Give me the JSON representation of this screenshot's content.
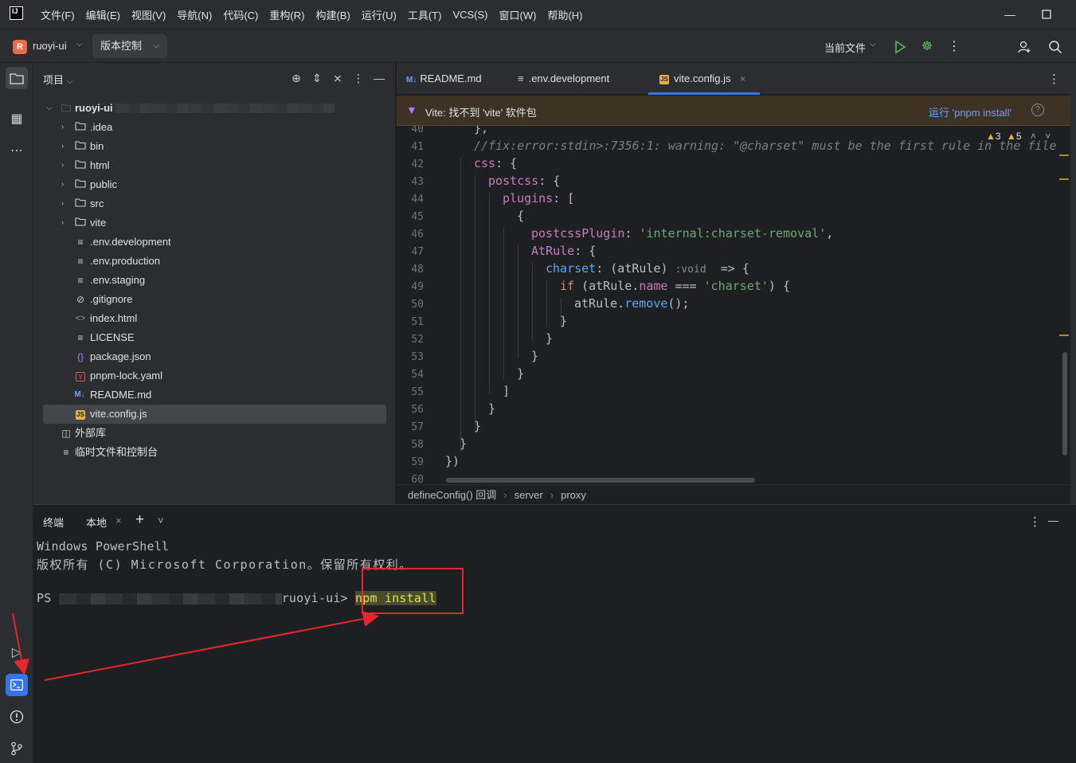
{
  "app": {
    "logo": "IJ",
    "menu": [
      "文件(F)",
      "编辑(E)",
      "视图(V)",
      "导航(N)",
      "代码(C)",
      "重构(R)",
      "构建(B)",
      "运行(U)",
      "工具(T)",
      "VCS(S)",
      "窗口(W)",
      "帮助(H)"
    ]
  },
  "toolbar": {
    "project_badge": "R",
    "project_name": "ruoyi-ui",
    "vcs_label": "版本控制",
    "run_config": "当前文件"
  },
  "project_panel": {
    "title": "项目",
    "root": "ruoyi-ui",
    "items": [
      {
        "label": ".idea",
        "type": "folder"
      },
      {
        "label": "bin",
        "type": "folder"
      },
      {
        "label": "html",
        "type": "folder"
      },
      {
        "label": "public",
        "type": "folder"
      },
      {
        "label": "src",
        "type": "folder"
      },
      {
        "label": "vite",
        "type": "folder"
      },
      {
        "label": ".env.development",
        "type": "text"
      },
      {
        "label": ".env.production",
        "type": "text"
      },
      {
        "label": ".env.staging",
        "type": "text"
      },
      {
        "label": ".gitignore",
        "type": "ignore"
      },
      {
        "label": "index.html",
        "type": "html"
      },
      {
        "label": "LICENSE",
        "type": "text"
      },
      {
        "label": "package.json",
        "type": "json"
      },
      {
        "label": "pnpm-lock.yaml",
        "type": "yaml"
      },
      {
        "label": "README.md",
        "type": "md"
      },
      {
        "label": "vite.config.js",
        "type": "js"
      }
    ],
    "external_libs": "外部库",
    "scratches": "临时文件和控制台"
  },
  "editor": {
    "tabs": [
      {
        "label": "README.md",
        "badge": "M↓"
      },
      {
        "label": ".env.development",
        "badge": "≡"
      },
      {
        "label": "vite.config.js",
        "badge": "JS"
      }
    ],
    "banner_text": "Vite: 找不到 'vite' 软件包",
    "banner_action": "运行 'pnpm install'",
    "warnings": "3",
    "weak_warnings": "5",
    "line_numbers": [
      "40",
      "41",
      "42",
      "43",
      "44",
      "45",
      "46",
      "47",
      "48",
      "49",
      "50",
      "51",
      "52",
      "53",
      "54",
      "55",
      "56",
      "57",
      "58",
      "59",
      "60"
    ],
    "code": {
      "l40": "},",
      "l41": "//fix:error:stdin>:7356:1: warning: \"@charset\" must be the first rule in the file",
      "l42_prop": "css",
      "l43_prop": "postcss",
      "l44_prop": "plugins",
      "l45": "{",
      "l46_prop": "postcssPlugin",
      "l46_str": "'internal:charset-removal'",
      "l47_prop": "AtRule",
      "l48_prop": "charset",
      "l48_param": "(atRule)",
      "l48_hint": ":void",
      "l48_arrow": "=> {",
      "l49_kw": "if",
      "l49_a": "(atRule.",
      "l49_prop": "name",
      "l49_op": "===",
      "l49_str": "'charset'",
      "l49_end": ") {",
      "l50_a": "atRule.",
      "l50_fn": "remove",
      "l50_end": "();",
      "l51": "}",
      "l52": "}",
      "l53": "}",
      "l54": "}",
      "l55": "]",
      "l56": "}",
      "l57": "}",
      "l58": "}",
      "l59": "})"
    },
    "breadcrumb": [
      "defineConfig() 回调",
      "server",
      "proxy"
    ]
  },
  "terminal": {
    "title": "终端",
    "tab_local": "本地",
    "lines": [
      "Windows PowerShell",
      "版权所有 (C) Microsoft Corporation。保留所有权利。"
    ],
    "prompt_prefix": "PS",
    "prompt_suffix": "ruoyi-ui>",
    "command": "npm install"
  },
  "colors": {
    "accent": "#3574f0",
    "annotation": "#e8262d"
  }
}
